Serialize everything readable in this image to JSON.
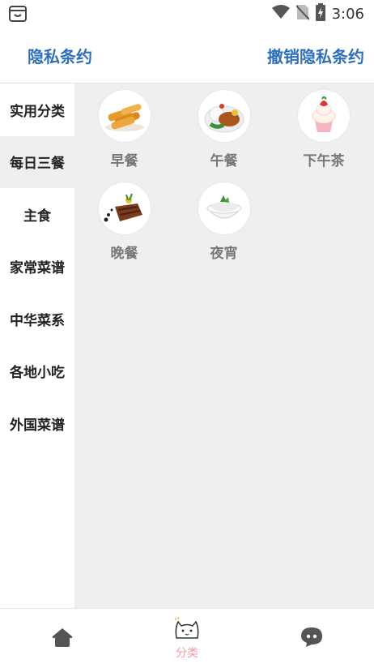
{
  "status_bar": {
    "time": "3:06",
    "icons": [
      "notification-icon",
      "wifi-icon",
      "no-sim-icon",
      "battery-charging-icon"
    ]
  },
  "header": {
    "left_link": "隐私条约",
    "right_link": "撤销隐私条约",
    "accent_color": "#2f6fb7"
  },
  "sidebar": {
    "items": [
      {
        "label": "实用分类",
        "selected": false
      },
      {
        "label": "每日三餐",
        "selected": true
      },
      {
        "label": "主食",
        "selected": false
      },
      {
        "label": "家常菜谱",
        "selected": false
      },
      {
        "label": "中华菜系",
        "selected": false
      },
      {
        "label": "各地小吃",
        "selected": false
      },
      {
        "label": "外国菜谱",
        "selected": false
      }
    ]
  },
  "meals": [
    {
      "label": "早餐",
      "icon": "spring-rolls-icon"
    },
    {
      "label": "午餐",
      "icon": "rice-plate-icon"
    },
    {
      "label": "下午茶",
      "icon": "cupcake-icon"
    },
    {
      "label": "晚餐",
      "icon": "steak-icon"
    },
    {
      "label": "夜宵",
      "icon": "rice-bowl-icon"
    }
  ],
  "tabbar": {
    "tabs": [
      {
        "icon": "home-icon",
        "label": ""
      },
      {
        "icon": "cat-icon",
        "label": "分类",
        "active": true
      },
      {
        "icon": "chat-icon",
        "label": ""
      }
    ],
    "active_color": "#f19aa1"
  }
}
